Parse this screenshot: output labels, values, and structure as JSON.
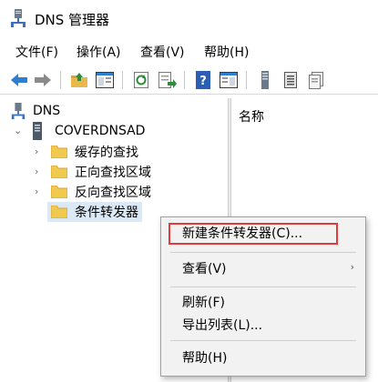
{
  "window": {
    "title": "DNS 管理器"
  },
  "menu": [
    "文件(F)",
    "操作(A)",
    "查看(V)",
    "帮助(H)"
  ],
  "toolbar": [
    "back-icon",
    "forward-icon",
    "up-folder-icon",
    "show-hide-tree-icon",
    "refresh-icon",
    "export-list-icon",
    "help-icon",
    "show-pane-icon",
    "server-icon",
    "zone-list-icon",
    "new-record-icon"
  ],
  "tree": {
    "root": "DNS",
    "server": "COVERDNSAD",
    "children": [
      "缓存的查找",
      "正向查找区域",
      "反向查找区域",
      "条件转发器"
    ]
  },
  "right_pane": {
    "column_header": "名称"
  },
  "context_menu": {
    "items": [
      "新建条件转发器(C)...",
      "查看(V)",
      "刷新(F)",
      "导出列表(L)...",
      "帮助(H)"
    ],
    "highlight_color": "#e03c3c"
  }
}
